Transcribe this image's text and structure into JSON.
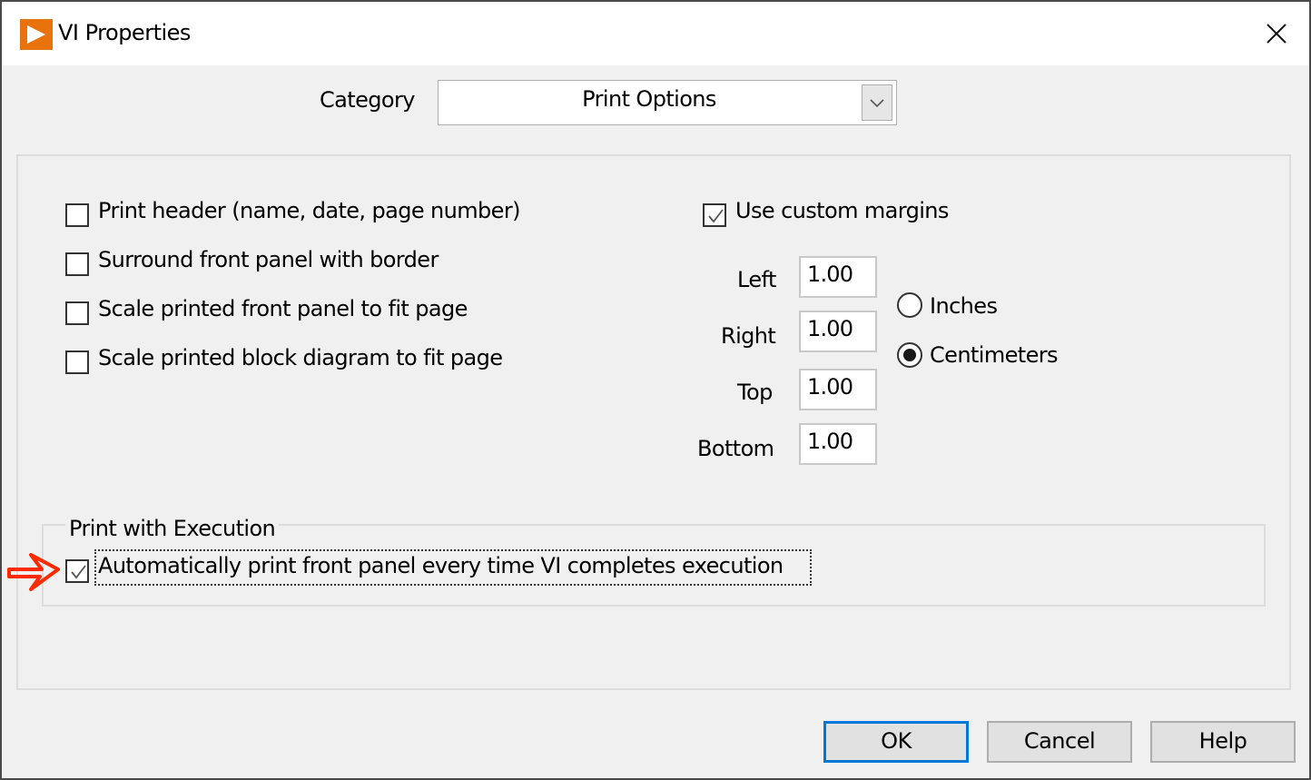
{
  "window": {
    "title": "VI Properties",
    "app_icon": "labview-play-icon",
    "close_icon": "close-icon"
  },
  "category": {
    "label": "Category",
    "selected": "Print Options"
  },
  "print_options": [
    {
      "label": "Print header (name, date, page number)",
      "checked": false
    },
    {
      "label": "Surround front panel with border",
      "checked": false
    },
    {
      "label": "Scale printed front panel to fit page",
      "checked": false
    },
    {
      "label": "Scale printed block diagram to fit page",
      "checked": false
    }
  ],
  "margins": {
    "use_custom_label": "Use custom margins",
    "use_custom_checked": true,
    "fields": [
      {
        "label": "Left",
        "value": "1.00"
      },
      {
        "label": "Right",
        "value": "1.00"
      },
      {
        "label": "Top",
        "value": "1.00"
      },
      {
        "label": "Bottom",
        "value": "1.00"
      }
    ],
    "units": [
      {
        "label": "Inches",
        "selected": false
      },
      {
        "label": "Centimeters",
        "selected": true
      }
    ]
  },
  "print_with_execution": {
    "legend": "Print with Execution",
    "option_label": "Automatically print front panel every time VI completes execution",
    "option_checked": true
  },
  "annotation": {
    "arrow_color": "#ff2a00"
  },
  "buttons": {
    "ok": "OK",
    "cancel": "Cancel",
    "help": "Help"
  },
  "colors": {
    "accent": "#0078d7",
    "app_icon_bg": "#e8730c"
  }
}
